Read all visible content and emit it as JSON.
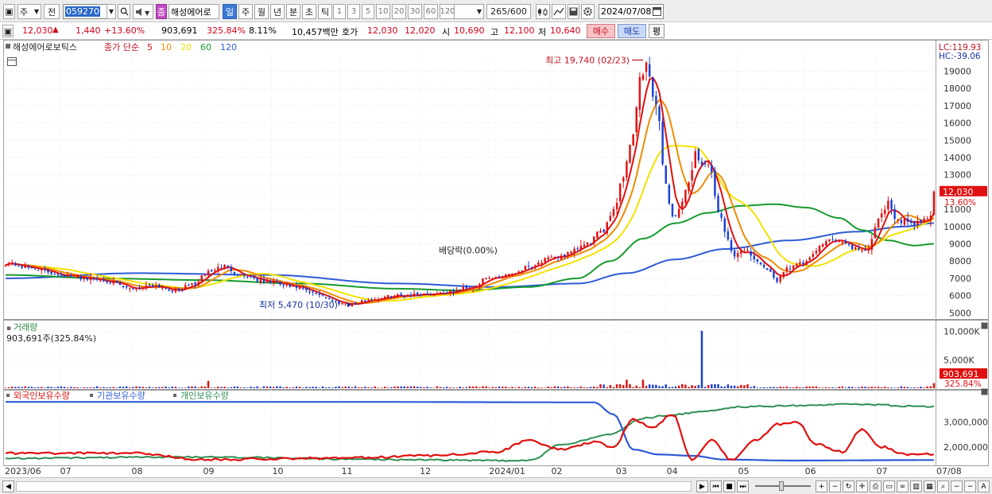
{
  "toolbar": {
    "market_label": "주",
    "prev_label": "전",
    "stock_code": "059270",
    "stock_name": "해성에어로",
    "name_badge": "종",
    "periods": [
      "일",
      "주",
      "월",
      "년",
      "분",
      "초",
      "틱"
    ],
    "selected_period": "일",
    "intervals": [
      "1",
      "3",
      "5",
      "10",
      "20",
      "30",
      "60",
      "120"
    ],
    "count_value": "265",
    "count_total": "/600",
    "date": "2024/07/08"
  },
  "quote": {
    "price": "12,030",
    "change": "1,440",
    "change_pct": "+13.60%",
    "volume": "903,691",
    "volume_ratio": "325.84%",
    "turnover": "8.11%",
    "amount": "10,457백만",
    "hoga_label": "호가",
    "ask": "12,030",
    "bid": "12,020",
    "open_label": "시",
    "open": "10,690",
    "high_label": "고",
    "high": "12,100",
    "low_label": "저",
    "low": "10,640",
    "buy_label": "매수",
    "sell_label": "매도",
    "avg_label": "평"
  },
  "price_panel": {
    "legend_name": "해성에어로보틱스",
    "legend_ma_label": "종가 단순",
    "ma_labels": [
      "5",
      "10",
      "20",
      "60",
      "120"
    ],
    "lc": "LC:119.93",
    "hc": "HC:-39.06",
    "max_label": "최고 19,740 (02/23)",
    "min_label": "최저 5,470 (10/30)",
    "dividend_label": "배당락(0.00%)",
    "last_price_tag": "12,030",
    "last_pct_tag": "13.60%"
  },
  "volume_panel": {
    "title": "거래량",
    "subtitle": "903,691주(325.84%)",
    "last_tag": "903,691",
    "last_pct": "325.84%"
  },
  "holder_panel": {
    "series_labels": [
      "외국인보유수량",
      "기관보유수량",
      "개인보유수량"
    ]
  },
  "colors": {
    "up": "#e01010",
    "down": "#1a3fd8",
    "ma5": "#e01010",
    "ma10": "#f08c00",
    "ma20": "#f2e200",
    "ma60": "#179a2e",
    "ma120": "#2e5bd6",
    "foreign": "#e01010",
    "institution": "#2e5bd6",
    "individual": "#2f8f52"
  },
  "chart_data": {
    "type": "candlestick",
    "x_ticks": [
      "2023/06",
      "07",
      "08",
      "09",
      "10",
      "11",
      "12",
      "2024/01",
      "02",
      "03",
      "04",
      "05",
      "06",
      "07",
      "07/08"
    ],
    "price_axis": {
      "ticks": [
        5000,
        6000,
        7000,
        8000,
        9000,
        10000,
        11000,
        12000,
        13000,
        14000,
        15000,
        16000,
        17000,
        18000,
        19000
      ],
      "ylim": [
        4600,
        19900
      ]
    },
    "volume_axis": {
      "ticks": [
        "5,000K",
        "10,000K"
      ],
      "ylim": [
        0,
        10500000
      ]
    },
    "holder_axis": {
      "ticks": [
        "2,000,000",
        "3,000,000"
      ],
      "ylim": [
        1300000,
        3900000
      ]
    },
    "price_keypoints": [
      [
        0,
        7900
      ],
      [
        8,
        7600
      ],
      [
        15,
        7300
      ],
      [
        22,
        7050
      ],
      [
        30,
        6900
      ],
      [
        38,
        6400
      ],
      [
        45,
        6600
      ],
      [
        52,
        6300
      ],
      [
        58,
        6700
      ],
      [
        62,
        7400
      ],
      [
        67,
        7700
      ],
      [
        72,
        7200
      ],
      [
        80,
        6800
      ],
      [
        88,
        6500
      ],
      [
        95,
        6100
      ],
      [
        102,
        5600
      ],
      [
        106,
        5500
      ],
      [
        112,
        5800
      ],
      [
        120,
        6000
      ],
      [
        128,
        6100
      ],
      [
        136,
        6200
      ],
      [
        142,
        6500
      ],
      [
        148,
        7000
      ],
      [
        155,
        7300
      ],
      [
        160,
        7700
      ],
      [
        166,
        8100
      ],
      [
        172,
        8400
      ],
      [
        177,
        8900
      ],
      [
        182,
        9600
      ],
      [
        186,
        11000
      ],
      [
        189,
        13000
      ],
      [
        192,
        15500
      ],
      [
        194,
        18500
      ],
      [
        196,
        19200
      ],
      [
        199,
        17000
      ],
      [
        202,
        12500
      ],
      [
        204,
        10500
      ],
      [
        206,
        11000
      ],
      [
        209,
        12600
      ],
      [
        211,
        14200
      ],
      [
        213,
        13500
      ],
      [
        215,
        13800
      ],
      [
        218,
        11000
      ],
      [
        220,
        9800
      ],
      [
        223,
        8200
      ],
      [
        226,
        8700
      ],
      [
        230,
        8000
      ],
      [
        233,
        7400
      ],
      [
        236,
        6900
      ],
      [
        239,
        7600
      ],
      [
        242,
        7800
      ],
      [
        245,
        7900
      ],
      [
        248,
        8600
      ],
      [
        251,
        9300
      ],
      [
        254,
        9200
      ],
      [
        257,
        9000
      ],
      [
        259,
        8800
      ],
      [
        262,
        8500
      ],
      [
        264,
        8800
      ],
      [
        266,
        9800
      ],
      [
        268,
        10800
      ],
      [
        270,
        11300
      ],
      [
        272,
        10500
      ],
      [
        275,
        10300
      ],
      [
        278,
        10000
      ],
      [
        280,
        10400
      ],
      [
        283,
        10700
      ],
      [
        284,
        12030
      ]
    ],
    "ma60_keypoints": [
      [
        0,
        7200
      ],
      [
        30,
        7000
      ],
      [
        60,
        6900
      ],
      [
        90,
        6700
      ],
      [
        120,
        6400
      ],
      [
        140,
        6300
      ],
      [
        160,
        6500
      ],
      [
        175,
        7000
      ],
      [
        185,
        8000
      ],
      [
        195,
        9300
      ],
      [
        205,
        10200
      ],
      [
        215,
        10800
      ],
      [
        225,
        11200
      ],
      [
        235,
        11300
      ],
      [
        245,
        11100
      ],
      [
        255,
        10500
      ],
      [
        262,
        9800
      ],
      [
        270,
        9200
      ],
      [
        278,
        8900
      ],
      [
        284,
        9000
      ]
    ],
    "ma120_keypoints": [
      [
        0,
        7000
      ],
      [
        40,
        7300
      ],
      [
        80,
        7200
      ],
      [
        120,
        6700
      ],
      [
        150,
        6500
      ],
      [
        175,
        6700
      ],
      [
        190,
        7300
      ],
      [
        205,
        8100
      ],
      [
        220,
        8700
      ],
      [
        240,
        9200
      ],
      [
        260,
        9700
      ],
      [
        275,
        10000
      ],
      [
        284,
        10200
      ]
    ],
    "holders": {
      "foreign": [
        [
          0,
          1750000
        ],
        [
          40,
          1750000
        ],
        [
          60,
          1500000
        ],
        [
          100,
          1550000
        ],
        [
          130,
          1650000
        ],
        [
          150,
          1800000
        ],
        [
          160,
          2250000
        ],
        [
          170,
          1900000
        ],
        [
          180,
          2200000
        ],
        [
          186,
          2000000
        ],
        [
          192,
          3100000
        ],
        [
          198,
          2800000
        ],
        [
          204,
          3300000
        ],
        [
          210,
          1500000
        ],
        [
          216,
          2300000
        ],
        [
          222,
          1500000
        ],
        [
          230,
          2300000
        ],
        [
          236,
          2900000
        ],
        [
          242,
          3000000
        ],
        [
          248,
          2100000
        ],
        [
          256,
          1800000
        ],
        [
          262,
          2700000
        ],
        [
          268,
          2000000
        ],
        [
          276,
          1700000
        ],
        [
          284,
          1700000
        ]
      ],
      "institution": [
        [
          0,
          3800000
        ],
        [
          100,
          3800000
        ],
        [
          180,
          3780000
        ],
        [
          186,
          3300000
        ],
        [
          192,
          1900000
        ],
        [
          200,
          1700000
        ],
        [
          210,
          1650000
        ],
        [
          220,
          1500000
        ],
        [
          240,
          1460000
        ],
        [
          284,
          1480000
        ]
      ],
      "individual": [
        [
          0,
          1550000
        ],
        [
          60,
          1600000
        ],
        [
          120,
          1500000
        ],
        [
          160,
          1450000
        ],
        [
          170,
          2100000
        ],
        [
          185,
          2500000
        ],
        [
          195,
          3150000
        ],
        [
          205,
          3300000
        ],
        [
          215,
          3450000
        ],
        [
          225,
          3600000
        ],
        [
          240,
          3650000
        ],
        [
          260,
          3700000
        ],
        [
          284,
          3600000
        ]
      ]
    }
  }
}
